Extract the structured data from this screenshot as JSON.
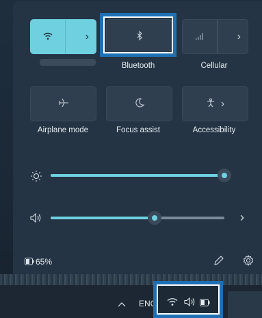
{
  "tiles_row1": [
    {
      "label": "",
      "icon": "wifi-icon",
      "active": true,
      "expand": "›"
    },
    {
      "label": "Bluetooth",
      "icon": "bluetooth-icon",
      "active": false
    },
    {
      "label": "Cellular",
      "icon": "cellular-icon",
      "active": false,
      "expand": "›"
    }
  ],
  "tiles_row2": [
    {
      "label": "Airplane mode",
      "icon": "airplane-icon"
    },
    {
      "label": "Focus assist",
      "icon": "moon-icon"
    },
    {
      "label": "Accessibility",
      "icon": "accessibility-icon",
      "expand": "›"
    }
  ],
  "brightness": {
    "value": 1.0
  },
  "volume": {
    "value": 0.6,
    "expand": "›"
  },
  "battery": {
    "percent_label": "65%"
  },
  "taskbar": {
    "language": "ENG",
    "chevron": "^"
  },
  "colors": {
    "accent": "#6fd0e0",
    "highlight_border": "#1f6fb3",
    "panel_bg": "#243444"
  }
}
